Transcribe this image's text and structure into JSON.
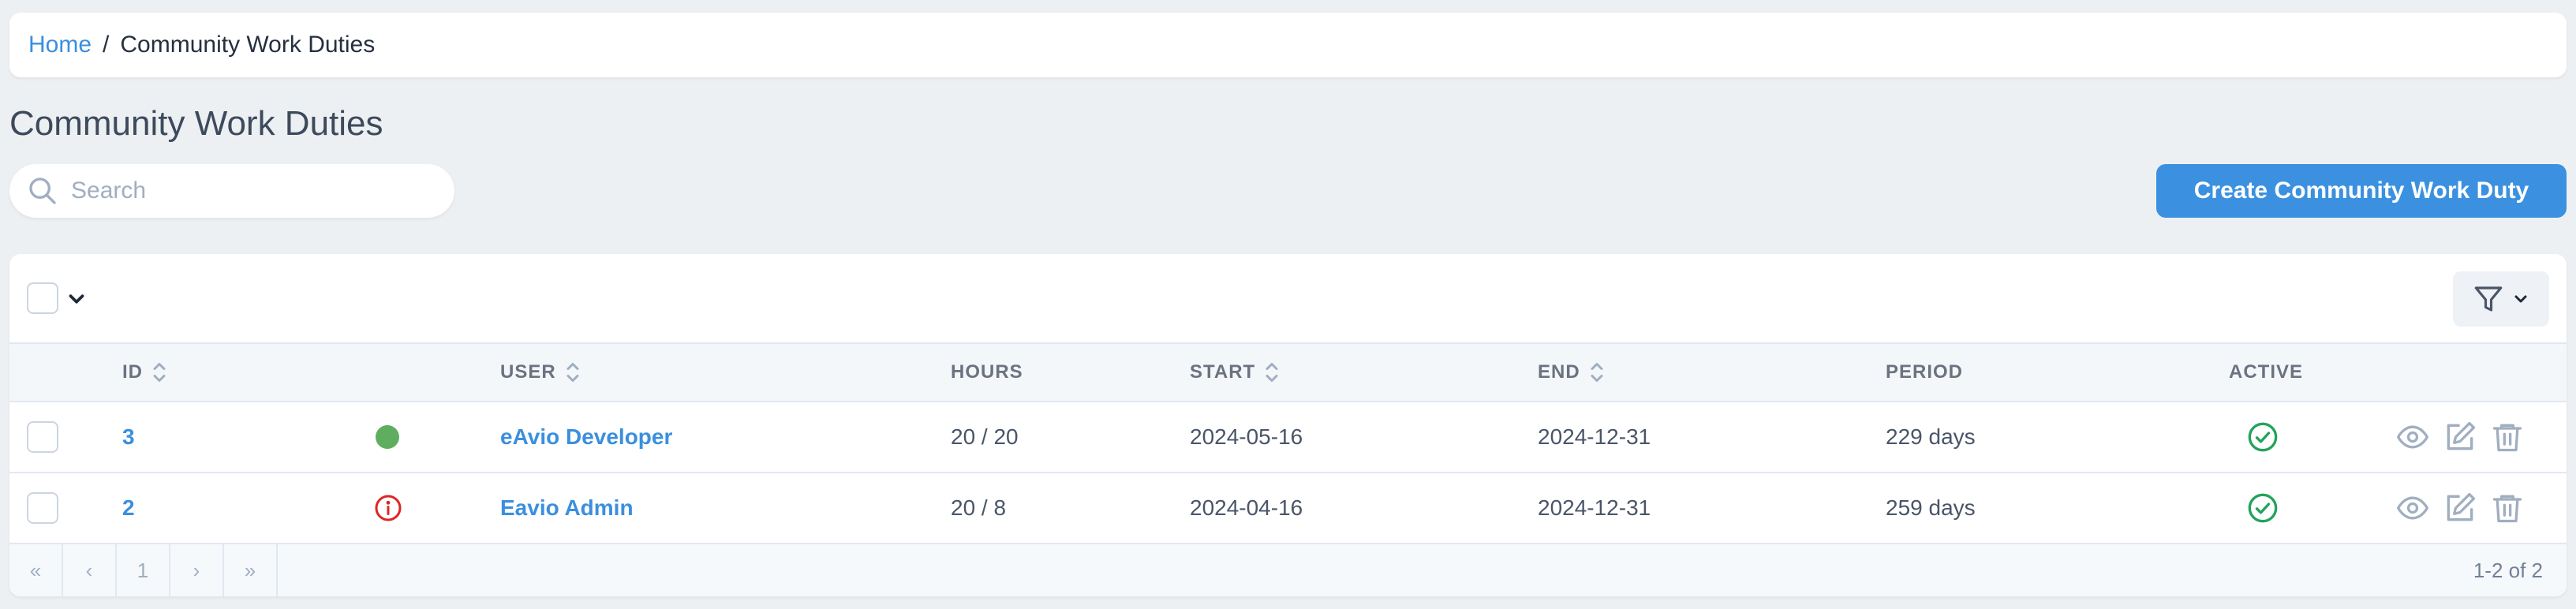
{
  "breadcrumb": {
    "home": "Home",
    "separator": "/",
    "current": "Community Work Duties"
  },
  "page_title": "Community Work Duties",
  "search": {
    "placeholder": "Search",
    "value": ""
  },
  "create_button": "Create Community Work Duty",
  "table": {
    "headers": {
      "id": "ID",
      "user": "USER",
      "hours": "HOURS",
      "start": "START",
      "end": "END",
      "period": "PERIOD",
      "active": "ACTIVE"
    },
    "rows": [
      {
        "id": "3",
        "status_icon": "green-dot-icon",
        "user": "eAvio Developer",
        "hours": "20 / 20",
        "start": "2024-05-16",
        "end": "2024-12-31",
        "period": "229 days",
        "active": true
      },
      {
        "id": "2",
        "status_icon": "red-info-icon",
        "user": "Eavio Admin",
        "hours": "20 / 8",
        "start": "2024-04-16",
        "end": "2024-12-31",
        "period": "259 days",
        "active": true
      }
    ]
  },
  "pagination": {
    "first": "«",
    "prev": "‹",
    "page": "1",
    "next": "›",
    "last": "»",
    "range": "1-2 of 2"
  },
  "colors": {
    "accent": "#3b91e0",
    "link": "#3b8fde",
    "status_ok": "#22a35a",
    "status_warn": "#e02424",
    "dot_green": "#5fae5f"
  }
}
